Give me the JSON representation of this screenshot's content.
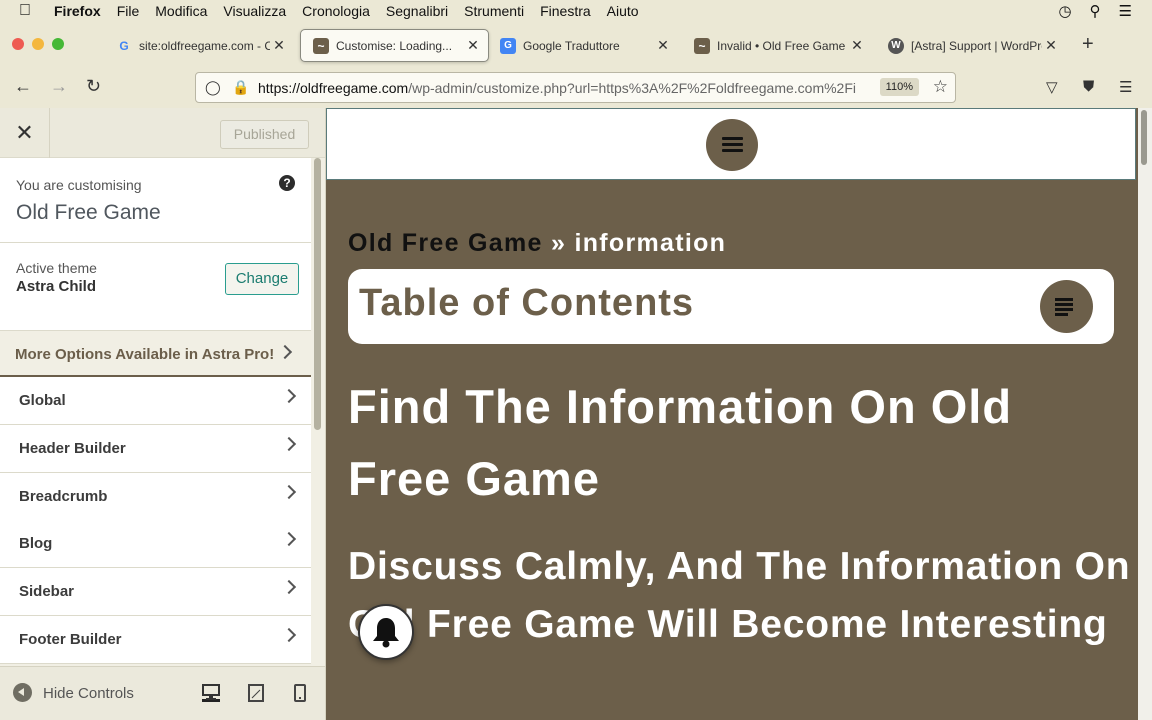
{
  "menubar": {
    "app": "Firefox",
    "items": [
      "File",
      "Modifica",
      "Visualizza",
      "Cronologia",
      "Segnalibri",
      "Strumenti",
      "Finestra",
      "Aiuto"
    ]
  },
  "tabs": [
    {
      "title": "site:oldfreegame.com - Cerca",
      "favicon": "google-icon"
    },
    {
      "title": "Customise: Loading...",
      "favicon": "oldfreegame-icon",
      "active": true
    },
    {
      "title": "Google Traduttore",
      "favicon": "google-translate-icon"
    },
    {
      "title": "Invalid • Old Free Game",
      "favicon": "oldfreegame-icon"
    },
    {
      "title": "[Astra] Support | WordPress",
      "favicon": "wordpress-icon"
    }
  ],
  "navbar": {
    "url_domain": "https://oldfreegame.com",
    "url_path": "/wp-admin/customize.php?url=https%3A%2F%2Foldfreegame.com%2Fi",
    "zoom": "110%"
  },
  "sidebar": {
    "published_label": "Published",
    "customising_label": "You are customising",
    "site_name": "Old Free Game",
    "active_theme_label": "Active theme",
    "theme_name": "Astra Child",
    "change_label": "Change",
    "promo_label": "More Options Available in Astra Pro!",
    "items": [
      "Global",
      "Header Builder",
      "Breadcrumb",
      "Blog",
      "Sidebar",
      "Footer Builder"
    ],
    "hide_controls_label": "Hide Controls"
  },
  "preview": {
    "breadcrumb_home": "Old Free Game",
    "breadcrumb_sep": "»",
    "breadcrumb_current": "information",
    "toc_title": "Table of Contents",
    "heading1": "Find The Information On Old Free Game",
    "heading2": "Discuss Calmly, And The Information On Old Free Game Will Become Interesting"
  },
  "colors": {
    "brand_brown": "#6c5f4a",
    "change_accent": "#2a9d8f"
  }
}
